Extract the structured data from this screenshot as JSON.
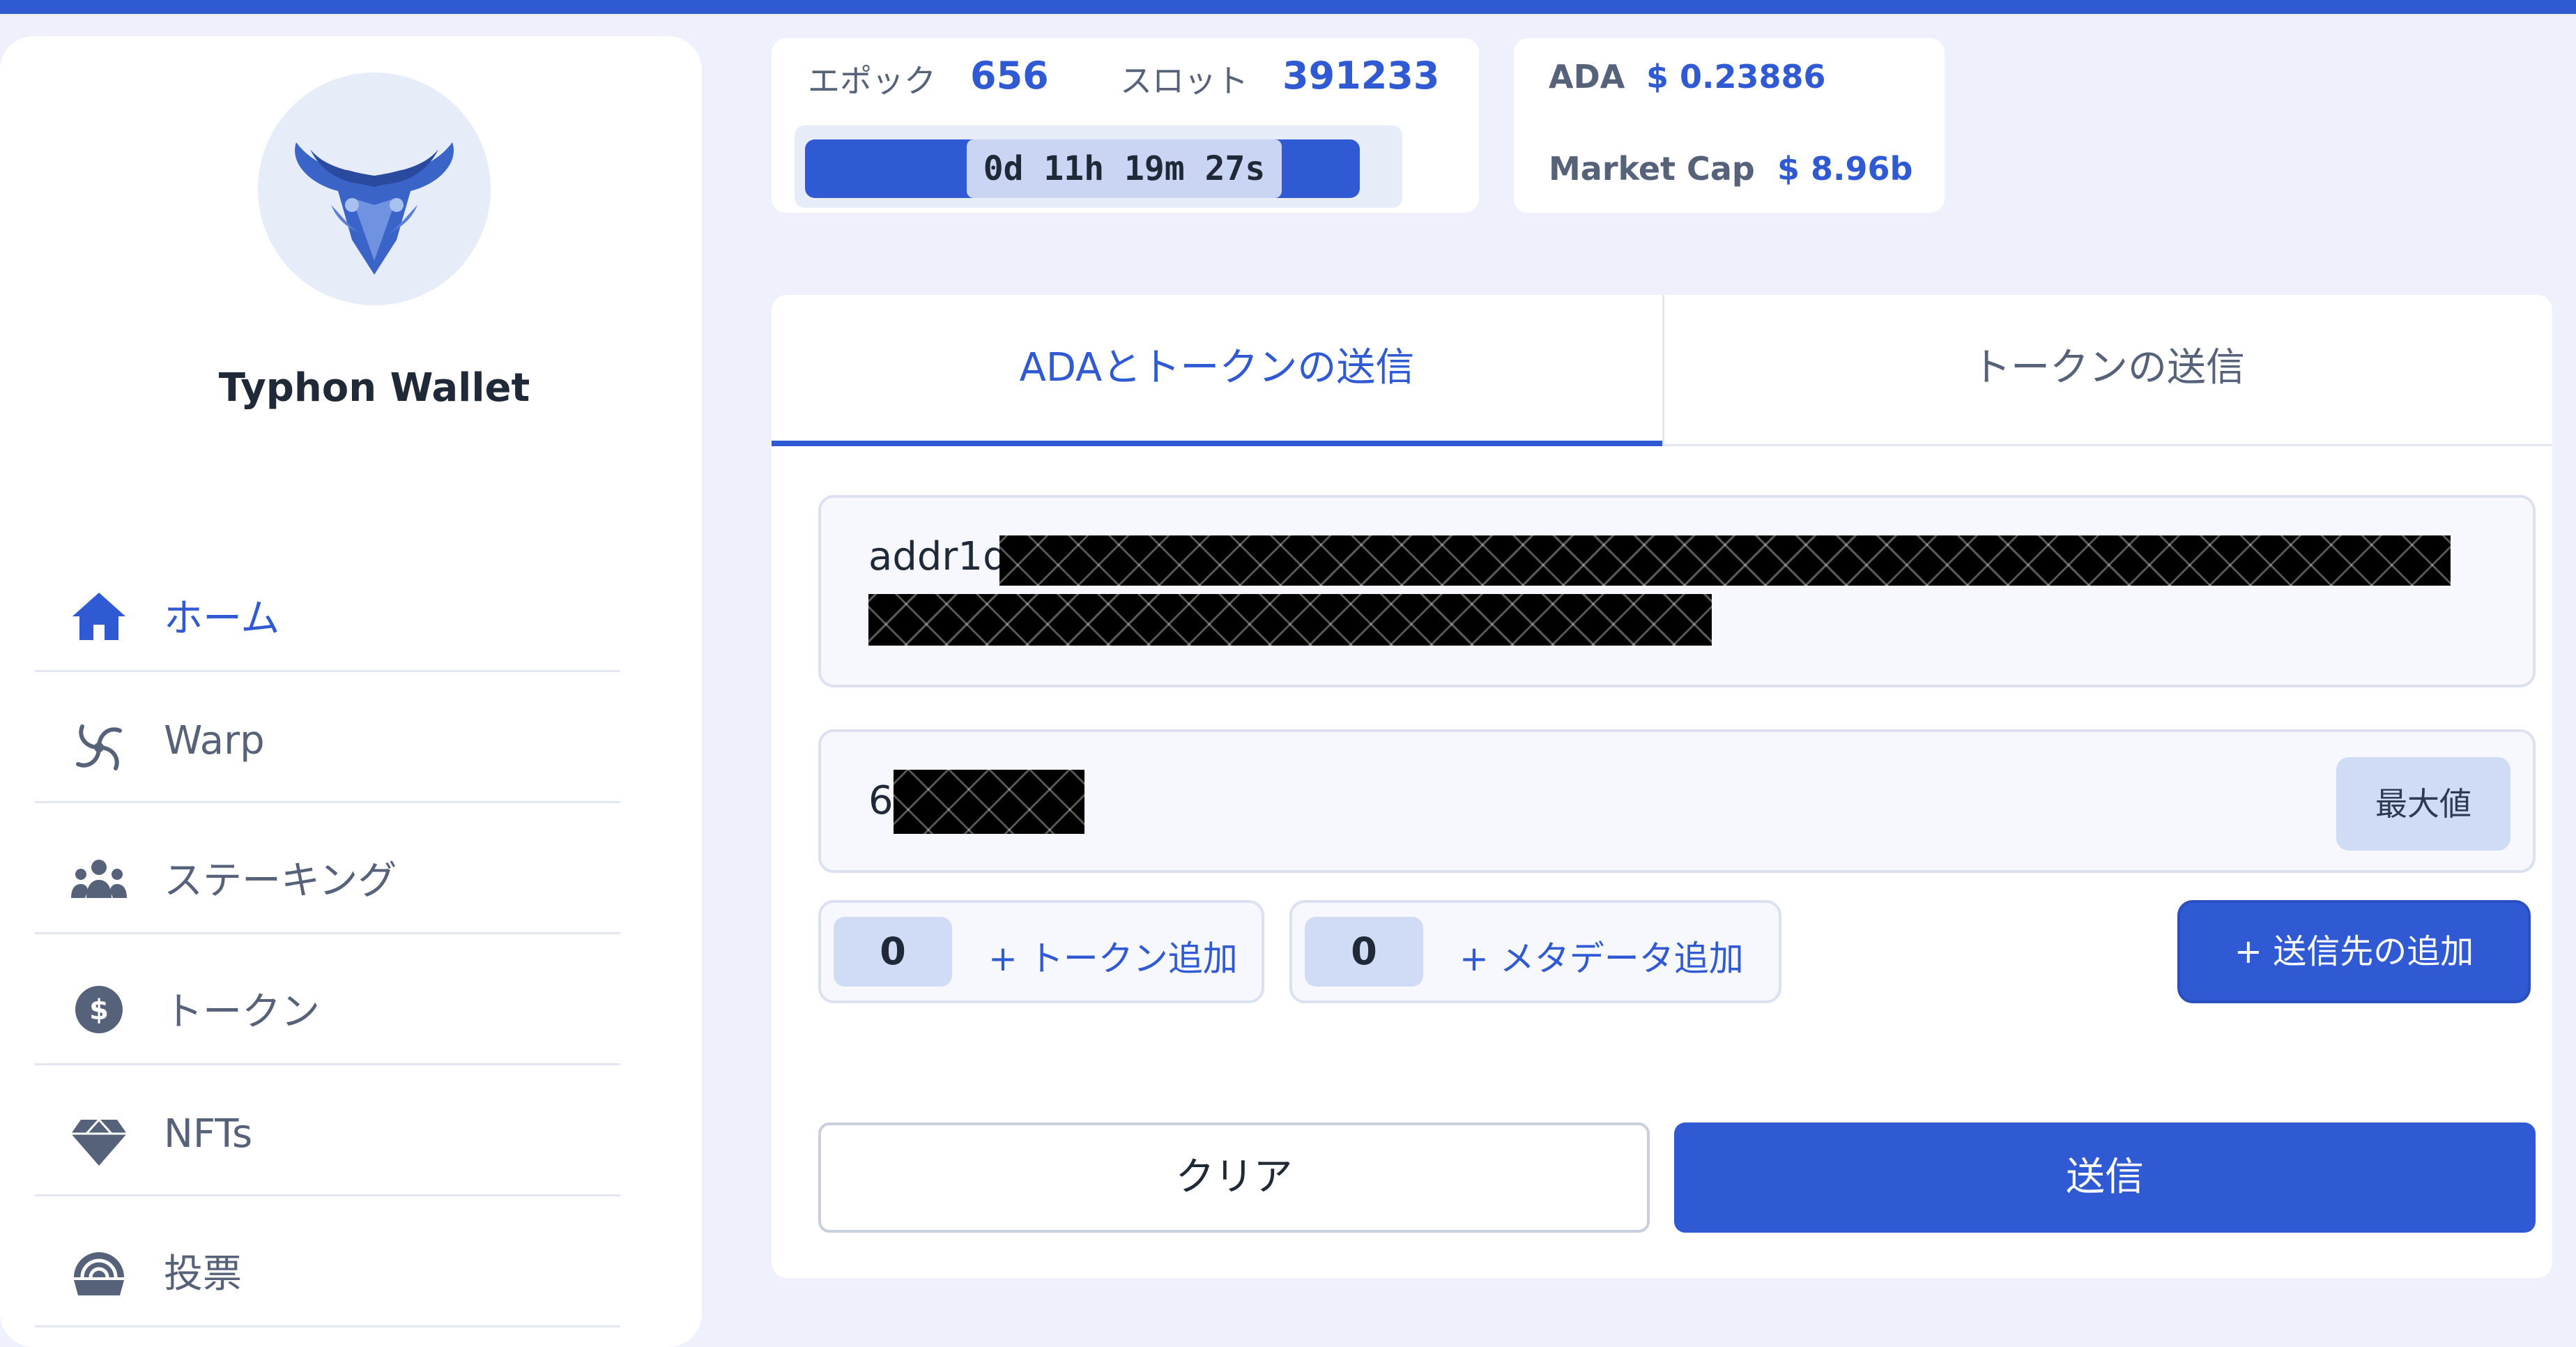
{
  "app": {
    "brand": "Typhon Wallet"
  },
  "sidebar": {
    "items": [
      {
        "label": "ホーム",
        "icon": "home-icon",
        "active": true
      },
      {
        "label": "Warp",
        "icon": "warp-icon",
        "active": false
      },
      {
        "label": "ステーキング",
        "icon": "staking-icon",
        "active": false
      },
      {
        "label": "トークン",
        "icon": "token-icon",
        "active": false
      },
      {
        "label": "NFTs",
        "icon": "nft-icon",
        "active": false
      },
      {
        "label": "投票",
        "icon": "vote-icon",
        "active": false
      }
    ]
  },
  "status": {
    "epoch_label": "エポック",
    "epoch_value": "656",
    "slot_label": "スロット",
    "slot_value": "391233",
    "countdown": "0d 11h 19m 27s",
    "epoch_progress": 0.945
  },
  "market": {
    "ada_label": "ADA",
    "ada_price": "$ 0.23886",
    "mcap_label": "Market Cap",
    "mcap_value": "$ 8.96b"
  },
  "tabs": [
    {
      "label": "ADAとトークンの送信",
      "active": true
    },
    {
      "label": "トークンの送信",
      "active": false
    }
  ],
  "send": {
    "address_value": "addr1q",
    "amount_value": "6",
    "max_label": "最大値",
    "token_count": "0",
    "add_token_label": "+ トークン追加",
    "metadata_count": "0",
    "add_metadata_label": "+ メタデータ追加",
    "add_recipient_label": "+  送信先の追加",
    "clear_label": "クリア",
    "send_label": "送信"
  },
  "colors": {
    "accent": "#3059d4",
    "background": "#eef1fb",
    "muted": "#56627a"
  }
}
